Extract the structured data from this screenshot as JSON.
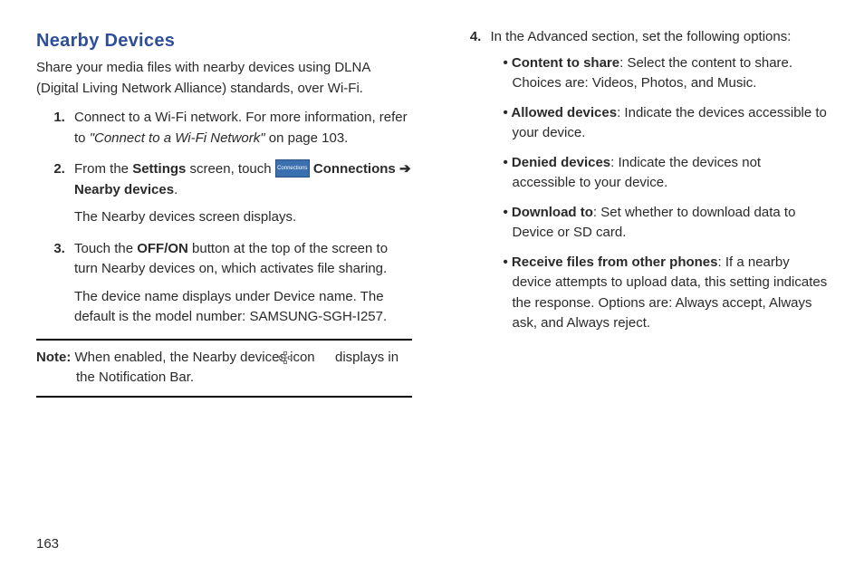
{
  "page_number": "163",
  "left": {
    "heading": "Nearby Devices",
    "intro": "Share your media files with nearby devices using DLNA (Digital Living Network Alliance) standards, over Wi-Fi.",
    "step1_a": "Connect to a Wi-Fi network. For more information, refer to ",
    "step1_link": "\"Connect to a Wi-Fi Network\"",
    "step1_b": " on page 103.",
    "step2_a": "From the ",
    "step2_settings": "Settings",
    "step2_b": " screen, touch ",
    "step2_icon_label": "Connections",
    "step2_conn": " Connections ",
    "step2_arrow": "➔ ",
    "step2_nearby": "Nearby devices",
    "step2_end": ".",
    "step2_sub": "The Nearby devices screen displays.",
    "step3_a": "Touch the ",
    "step3_offon": "OFF/ON",
    "step3_b": " button at the top of the screen to turn Nearby devices on, which activates file sharing.",
    "step3_sub": "The device name displays under Device name. The default is the model number: SAMSUNG-SGH-I257.",
    "note_label": "Note:",
    "note_a": " When enabled, the Nearby devices icon ",
    "note_b": " displays in the Notification Bar."
  },
  "right": {
    "step4_a": "In the Advanced section, set the following options:",
    "b1_label": "Content to share",
    "b1_text": ": Select the content to share. Choices are: Videos, Photos, and Music.",
    "b2_label": "Allowed devices",
    "b2_text": ": Indicate the devices accessible to your device.",
    "b3_label": "Denied devices",
    "b3_text": ": Indicate the devices not accessible to your device.",
    "b4_label": "Download to",
    "b4_text": ": Set whether to download data to Device or SD card.",
    "b5_label": "Receive files from other phones",
    "b5_text": ": If a nearby device attempts to upload data, this setting indicates the response. Options are: Always accept, Always ask, and Always reject."
  }
}
